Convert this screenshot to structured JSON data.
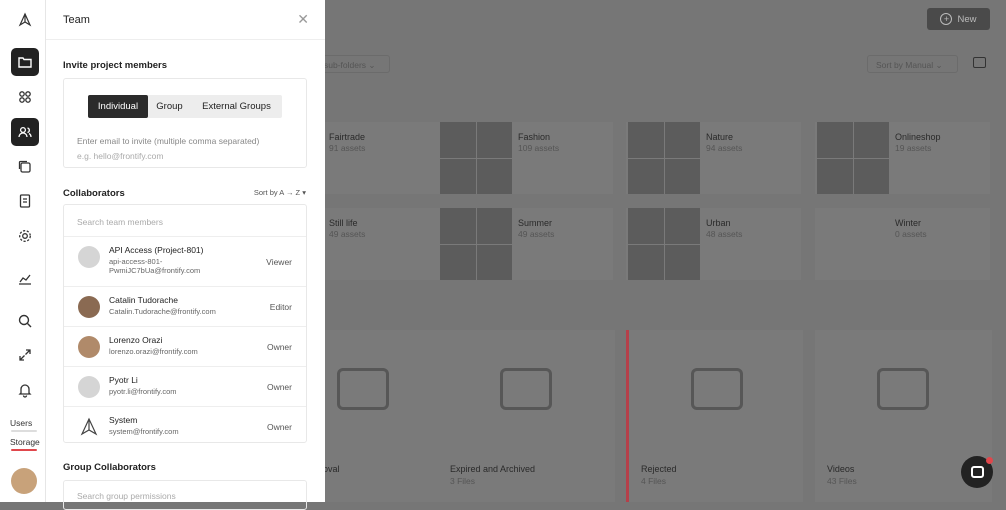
{
  "panel": {
    "title": "Team",
    "invite_title": "Invite project members",
    "tabs": [
      "Individual",
      "Group",
      "External Groups"
    ],
    "invite_help": "Enter email to invite (multiple comma separated)",
    "invite_placeholder": "e.g. hello@frontify.com",
    "collaborators_title": "Collaborators",
    "sort_label": "Sort by A → Z",
    "search_placeholder": "Search team members",
    "members": [
      {
        "name": "API Access (Project-801)",
        "email": "api-access-801-PwmiJC7bUa@frontify.com",
        "role": "Viewer"
      },
      {
        "name": "Catalin Tudorache",
        "email": "Catalin.Tudorache@frontify.com",
        "role": "Editor"
      },
      {
        "name": "Lorenzo Orazi",
        "email": "lorenzo.orazi@frontify.com",
        "role": "Owner"
      },
      {
        "name": "Pyotr Li",
        "email": "pyotr.li@frontify.com",
        "role": "Owner"
      },
      {
        "name": "System",
        "email": "system@frontify.com",
        "role": "Owner"
      }
    ],
    "group_title": "Group Collaborators",
    "group_search_placeholder": "Search group permissions"
  },
  "rail": {
    "users_label": "Users",
    "storage_label": "Storage",
    "icons": [
      "folder-icon",
      "apps-icon",
      "users-icon",
      "collections-icon",
      "document-icon",
      "settings-icon",
      "chart-icon",
      "search-icon",
      "expand-icon",
      "bell-icon"
    ]
  },
  "main": {
    "new_label": "New",
    "subfolders_label": "sub-folders",
    "sort_label": "Sort by Manual",
    "collections": [
      {
        "title": "Fairtrade",
        "sub": "91 assets"
      },
      {
        "title": "Fashion",
        "sub": "109 assets"
      },
      {
        "title": "Nature",
        "sub": "94 assets"
      },
      {
        "title": "Onlineshop",
        "sub": "19 assets"
      },
      {
        "title": "Still life",
        "sub": "49 assets"
      },
      {
        "title": "Summer",
        "sub": "49 assets"
      },
      {
        "title": "Urban",
        "sub": "48 assets"
      },
      {
        "title": "Winter",
        "sub": "0 assets"
      }
    ],
    "folders": [
      {
        "title": "oval",
        "sub": ""
      },
      {
        "title": "Expired and Archived",
        "sub": "3 Files"
      },
      {
        "title": "Rejected",
        "sub": "4 Files"
      },
      {
        "title": "Videos",
        "sub": "43 Files"
      }
    ]
  },
  "colors": {
    "accent_dark": "#222222",
    "overlay": "#767676",
    "storage_bar": "#e0474c"
  }
}
